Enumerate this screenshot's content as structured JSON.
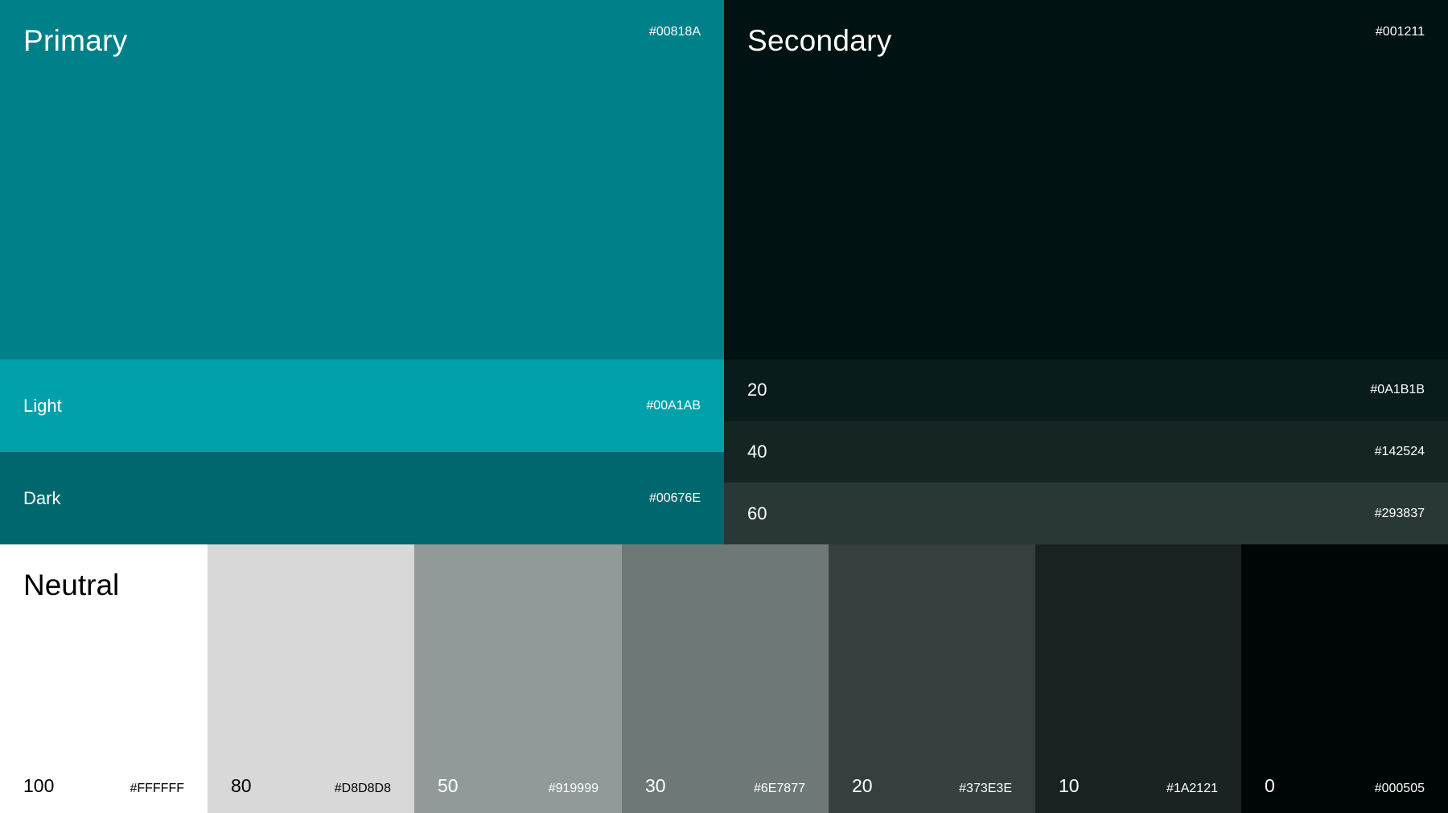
{
  "primary": {
    "title": "Primary",
    "hex": "#00818A",
    "color": "#00818A",
    "shades": [
      {
        "label": "Light",
        "hex": "#00A1AB",
        "color": "#00A1AB"
      },
      {
        "label": "Dark",
        "hex": "#00676E",
        "color": "#00676E"
      }
    ]
  },
  "secondary": {
    "title": "Secondary",
    "hex": "#001211",
    "color": "#001211",
    "shades": [
      {
        "label": "20",
        "hex": "#0A1B1B",
        "color": "#0A1B1B"
      },
      {
        "label": "40",
        "hex": "#142524",
        "color": "#142524"
      },
      {
        "label": "60",
        "hex": "#293837",
        "color": "#293837"
      }
    ]
  },
  "neutral": {
    "title": "Neutral",
    "swatches": [
      {
        "level": "100",
        "hex": "#FFFFFF",
        "color": "#FFFFFF",
        "text_color": "#000000"
      },
      {
        "level": "80",
        "hex": "#D8D8D8",
        "color": "#D8D8D8",
        "text_color": "#000000"
      },
      {
        "level": "50",
        "hex": "#919999",
        "color": "#919999",
        "text_color": "#FFFFFF"
      },
      {
        "level": "30",
        "hex": "#6E7877",
        "color": "#6E7877",
        "text_color": "#FFFFFF"
      },
      {
        "level": "20",
        "hex": "#373E3E",
        "color": "#373E3E",
        "text_color": "#FFFFFF"
      },
      {
        "level": "10",
        "hex": "#1A2121",
        "color": "#1A2121",
        "text_color": "#FFFFFF"
      },
      {
        "level": "0",
        "hex": "#000505",
        "color": "#000505",
        "text_color": "#FFFFFF"
      }
    ]
  }
}
